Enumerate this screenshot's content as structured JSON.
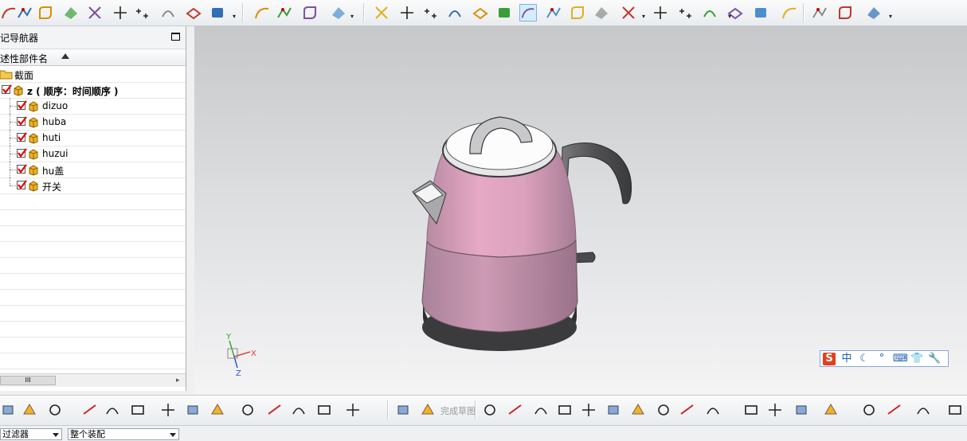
{
  "navigator": {
    "title": "记导航器",
    "column_header": "述性部件名",
    "rows": [
      {
        "label": "截面",
        "type": "folder"
      },
      {
        "label": "z ( 顺序：时间顺序 )",
        "type": "assembly",
        "checked": true
      },
      {
        "label": "dizuo",
        "type": "part",
        "checked": true
      },
      {
        "label": "huba",
        "type": "part",
        "checked": true
      },
      {
        "label": "huti",
        "type": "part",
        "checked": true
      },
      {
        "label": "huzui",
        "type": "part",
        "checked": true
      },
      {
        "label": "hu盖",
        "type": "part",
        "checked": true
      },
      {
        "label": "开关",
        "type": "part",
        "checked": true
      }
    ],
    "scroll_thumb": "III"
  },
  "toolbar_top": {
    "icons": [
      "arc-icon",
      "sketch-point-icon",
      "fillet-curve-icon",
      "surface-icon",
      "curve-intersection-icon",
      "plus-point-icon",
      "point-set-icon",
      "offset-curve-icon",
      "project-curve-icon",
      "wrap-curve-icon",
      "cylinder-tube-icon",
      "spring-icon",
      "coil-icon",
      "cut-tool-icon",
      "movie-clapper-icon",
      "camera-icon",
      "paint-brush-icon",
      "color-palette-icon",
      "material-icon",
      "lamp-icon",
      "light-bulb-icon",
      "user-icon",
      "portrait-icon",
      "gallery-icon",
      "monitor-icon",
      "cloud-icon",
      "shaded-box-icon",
      "image-frame-icon",
      "wireframe-cube-icon",
      "hidden-line-cube-icon",
      "select-rectangle-icon",
      "eraser-icon",
      "paint-bucket-icon",
      "highlight-icon"
    ]
  },
  "toolbar_bottom": {
    "sketch_label": "完成草图"
  },
  "filterbar": {
    "filter_value": "过滤器",
    "assembly_value": "整个装配"
  },
  "viewport": {
    "triad": {
      "x": "X",
      "y": "Y",
      "z": "Z"
    },
    "colors": {
      "body": "#e6a9c6",
      "lid": "#ffffff",
      "base": "#3d3d3f",
      "handle": "#5c5c5e"
    }
  },
  "ime": {
    "items": [
      "S",
      "中",
      "☾",
      "°",
      "⌨",
      "👕",
      "🔧"
    ]
  }
}
